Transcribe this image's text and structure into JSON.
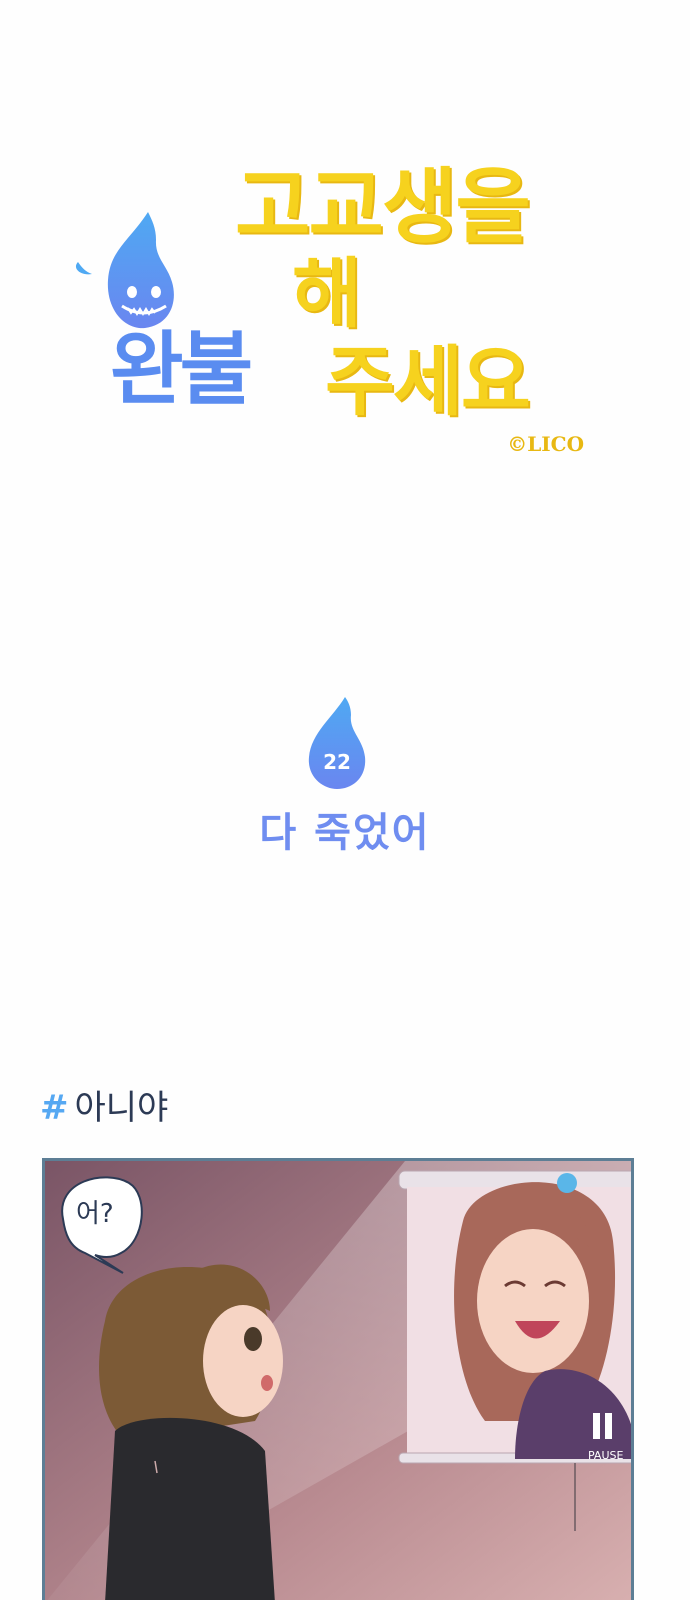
{
  "series_title": {
    "line1": "고교생을",
    "line2_blue": "완불",
    "line2_yellow": "해",
    "line3": "주세요",
    "copyright": "©LICO"
  },
  "episode": {
    "number": "22",
    "title": "다 죽었어"
  },
  "hashtag": {
    "symbol": "#",
    "text": "아니야"
  },
  "panel": {
    "speech": "어?",
    "screen_label": "PAUSE"
  },
  "colors": {
    "title_yellow": "#f6d21e",
    "title_blue": "#5a8cf0",
    "episode_blue": "#6f8df0",
    "hash_blue": "#56a8f2",
    "panel_border": "#5d7e95"
  }
}
